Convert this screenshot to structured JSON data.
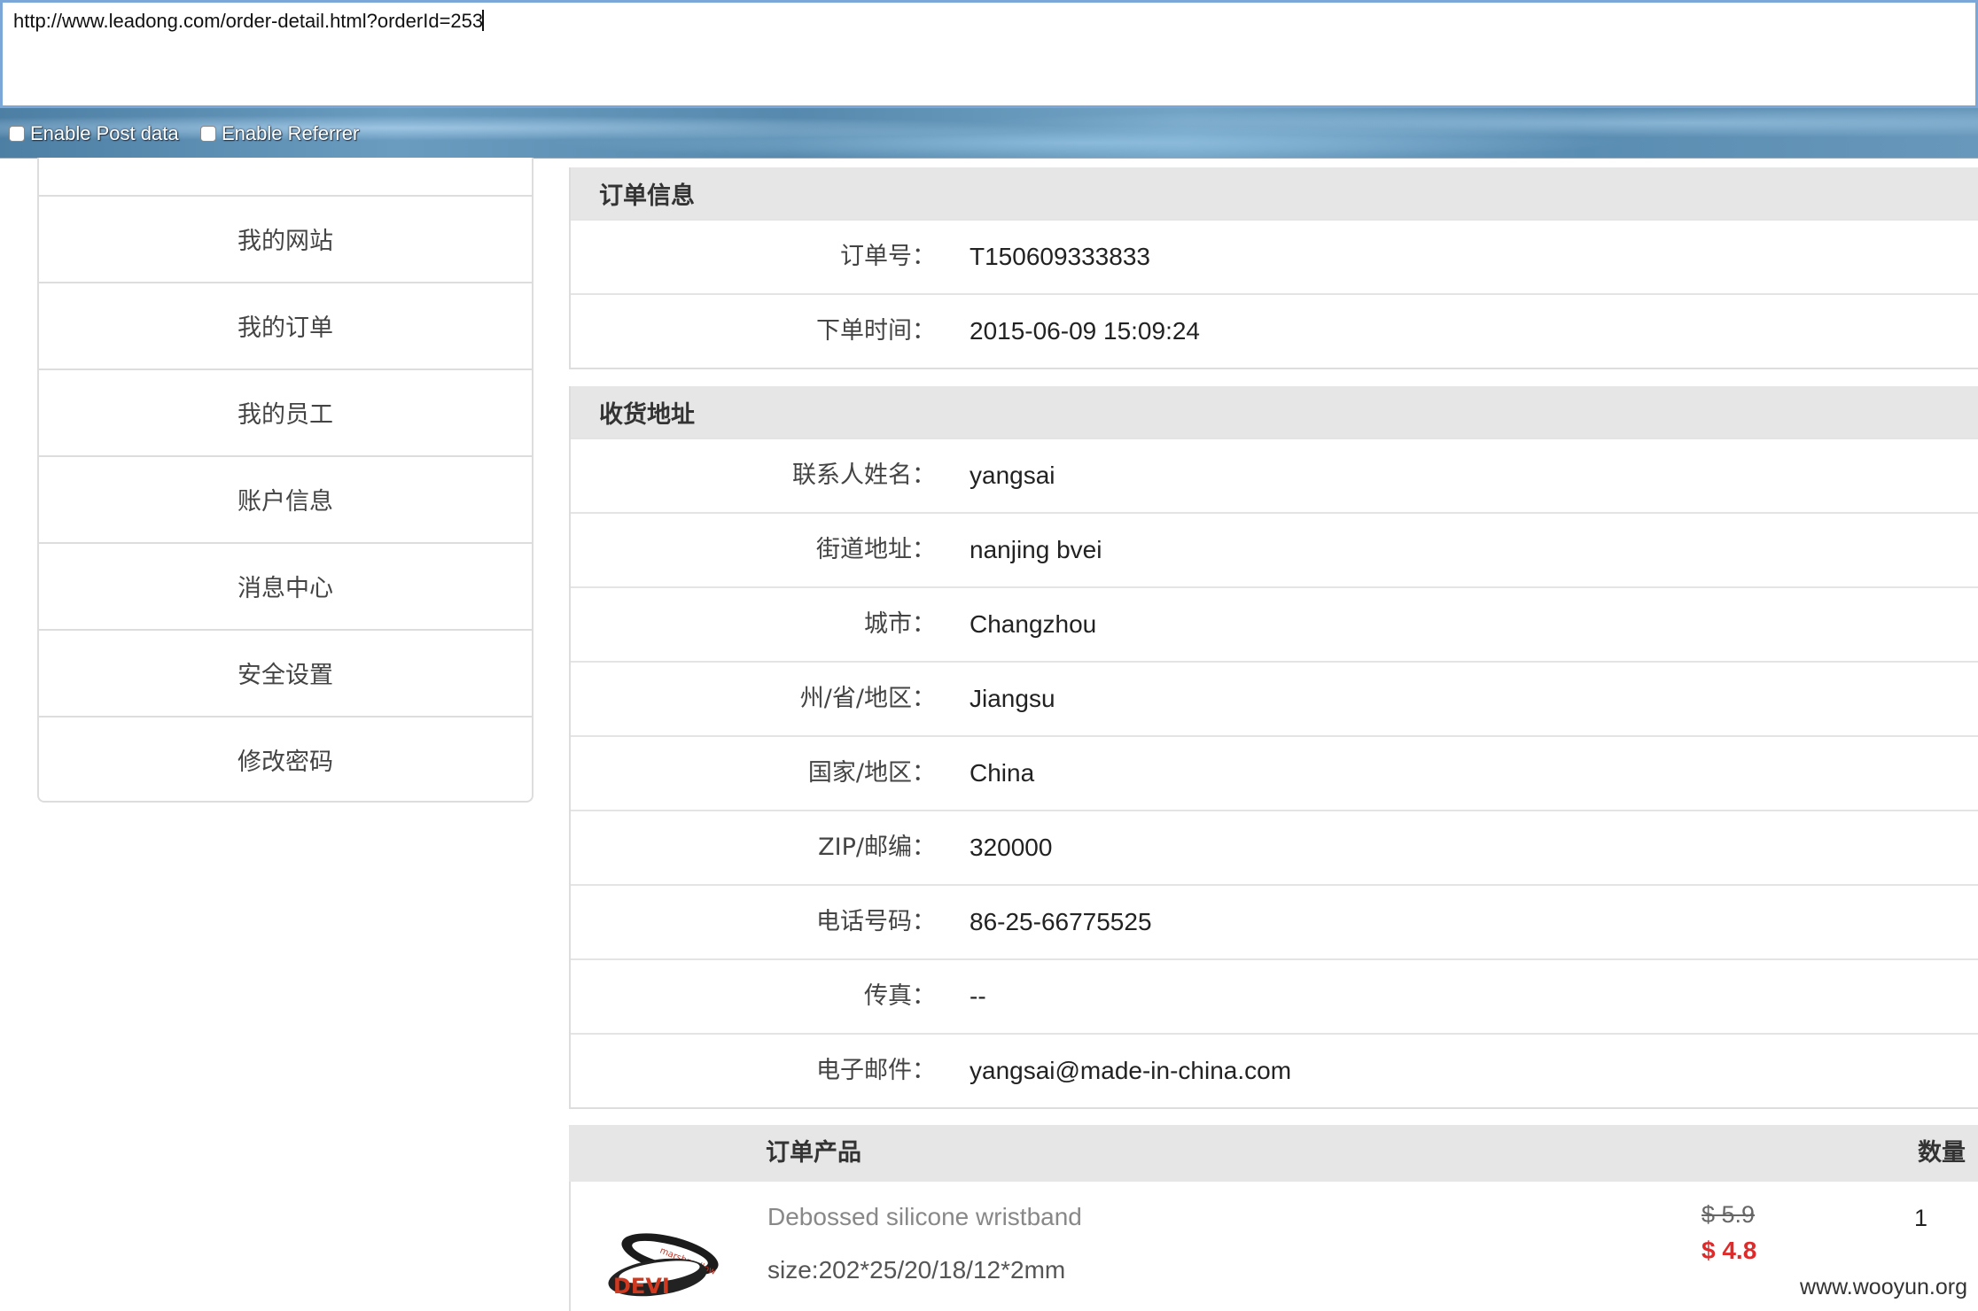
{
  "browser": {
    "url": "http://www.leadong.com/order-detail.html?orderId=253",
    "options": [
      {
        "label": "Enable Post data",
        "checked": false
      },
      {
        "label": "Enable Referrer",
        "checked": false
      }
    ]
  },
  "sidebar": {
    "items": [
      {
        "label": "我的网站"
      },
      {
        "label": "我的订单"
      },
      {
        "label": "我的员工"
      },
      {
        "label": "账户信息"
      },
      {
        "label": "消息中心"
      },
      {
        "label": "安全设置"
      },
      {
        "label": "修改密码"
      }
    ]
  },
  "order_info": {
    "title": "订单信息",
    "rows": [
      {
        "key": "订单号：",
        "value": "T150609333833"
      },
      {
        "key": "下单时间：",
        "value": "2015-06-09 15:09:24"
      }
    ]
  },
  "shipping": {
    "title": "收货地址",
    "rows": [
      {
        "key": "联系人姓名：",
        "value": "yangsai"
      },
      {
        "key": "街道地址：",
        "value": "nanjing bvei"
      },
      {
        "key": "城市：",
        "value": "Changzhou"
      },
      {
        "key": "州/省/地区：",
        "value": "Jiangsu"
      },
      {
        "key": "国家/地区：",
        "value": "China"
      },
      {
        "key": "ZIP/邮编：",
        "value": "320000"
      },
      {
        "key": "电话号码：",
        "value": "86-25-66775525"
      },
      {
        "key": "传真：",
        "value": "--"
      },
      {
        "key": "电子邮件：",
        "value": "yangsai@made-in-china.com"
      }
    ]
  },
  "products": {
    "header_product": "订单产品",
    "header_qty": "数量",
    "items": [
      {
        "name": "Debossed silicone wristband",
        "size": "size:202*25/20/18/12*2mm",
        "original_price": "$ 5.9",
        "price": "$ 4.8",
        "quantity": "1",
        "image_text": "DEVI"
      }
    ]
  },
  "watermark": "www.wooyun.org",
  "colors": {
    "url_border": "#7aa6d8",
    "header_bg": "#e6e6e6",
    "sale_price": "#e02a2a"
  }
}
